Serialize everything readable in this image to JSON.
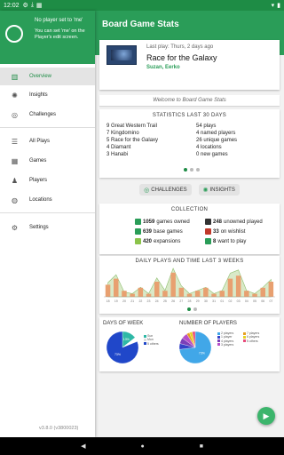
{
  "status": {
    "time": "12:02",
    "left_icons": [
      "gear-icon",
      "download-icon",
      "calendar-icon"
    ],
    "right_icons": [
      "wifi-icon",
      "battery-icon"
    ]
  },
  "app": {
    "title": "Board Game Stats",
    "last_play": {
      "label": "Last play: Thurs, 2 days ago",
      "game": "Race for the Galaxy",
      "players": "Suzan, Eerko"
    },
    "welcome": "Welcome to Board Game Stats",
    "statistics": {
      "title": "STATISTICS LAST 30 DAYS",
      "left": [
        "9 Great Western Trail",
        "7 Kingdomino",
        "5 Race for the Galaxy",
        "4 Diamant",
        "3 Hanabi"
      ],
      "right": [
        "54 plays",
        "4 named players",
        "26 unique games",
        "4 locations",
        "0 new games"
      ]
    },
    "chips": {
      "challenges": "CHALLENGES",
      "insights": "INSIGHTS"
    },
    "collection": {
      "title": "COLLECTION",
      "items": [
        {
          "count": "1059",
          "label": "games owned",
          "color": "#2a9d58"
        },
        {
          "count": "248",
          "label": "unowned played",
          "color": "#333333"
        },
        {
          "count": "639",
          "label": "base games",
          "color": "#2a9d58"
        },
        {
          "count": "33",
          "label": "on wishlist",
          "color": "#c0392b"
        },
        {
          "count": "420",
          "label": "expansions",
          "color": "#8bc34a"
        },
        {
          "count": "8",
          "label": "want to play",
          "color": "#2a9d58"
        }
      ]
    },
    "daily_plays": {
      "title": "DAILY PLAYS AND TIME LAST 3 WEEKS"
    },
    "days_of_week": {
      "title": "DAYS OF WEEK",
      "legend": [
        "Sun",
        "Mon",
        "5 others"
      ]
    },
    "number_of_players": {
      "title": "NUMBER OF PLAYERS",
      "legend": [
        "2 players",
        "1 player",
        "4 players",
        "3 players",
        "7 players",
        "6 players",
        "5 others"
      ]
    },
    "colors": {
      "primary": "#2a9d58",
      "accent": "#3cb56c",
      "dark": "#1e8c45"
    }
  },
  "drawer": {
    "player_name": "No player set to 'me'",
    "hint": "You can set 'me' on the Player's edit screen.",
    "items": [
      {
        "label": "Overview",
        "icon": "chart-icon"
      },
      {
        "label": "Insights",
        "icon": "lightbulb-icon"
      },
      {
        "label": "Challenges",
        "icon": "target-icon"
      },
      {
        "label": "All Plays",
        "icon": "list-icon"
      },
      {
        "label": "Games",
        "icon": "checkerboard-icon"
      },
      {
        "label": "Players",
        "icon": "person-icon"
      },
      {
        "label": "Locations",
        "icon": "globe-icon"
      },
      {
        "label": "Settings",
        "icon": "gear-icon"
      }
    ],
    "version": "v3.8.0 (v3800023)"
  },
  "chart_data": [
    {
      "type": "bar",
      "title": "DAILY PLAYS AND TIME LAST 3 WEEKS",
      "categories": [
        "18",
        "19",
        "20",
        "21",
        "22",
        "23",
        "24",
        "25",
        "26",
        "27",
        "28",
        "29",
        "30",
        "31",
        "01",
        "02",
        "03",
        "04",
        "05",
        "06",
        "07"
      ],
      "series": [
        {
          "values": [
            4,
            6,
            2,
            1,
            3,
            1,
            5,
            2,
            8,
            3,
            1,
            2,
            3,
            1,
            2,
            6,
            7,
            2,
            1,
            3,
            5
          ]
        },
        {
          "values": [
            90,
            140,
            30,
            20,
            60,
            20,
            120,
            40,
            180,
            70,
            20,
            40,
            60,
            20,
            40,
            150,
            170,
            40,
            20,
            60,
            110
          ]
        }
      ]
    },
    {
      "type": "pie",
      "title": "DAYS OF WEEK",
      "labels": [
        "Sun",
        "Mon",
        "5 others"
      ],
      "values": [
        13,
        4,
        73
      ],
      "colors": [
        "#2eb8a6",
        "#ffffff",
        "#2047c9"
      ]
    },
    {
      "type": "pie",
      "title": "NUMBER OF PLAYERS",
      "labels": [
        "2 players",
        "1 player",
        "4 players",
        "3 players",
        "7 players",
        "6 players",
        "5 others"
      ],
      "values": [
        73,
        6,
        6,
        6,
        3,
        3,
        3
      ],
      "colors": [
        "#41a7e8",
        "#3442c8",
        "#7b3fb8",
        "#b64fc8",
        "#e6a020",
        "#e6d220",
        "#e84a7a"
      ]
    }
  ]
}
